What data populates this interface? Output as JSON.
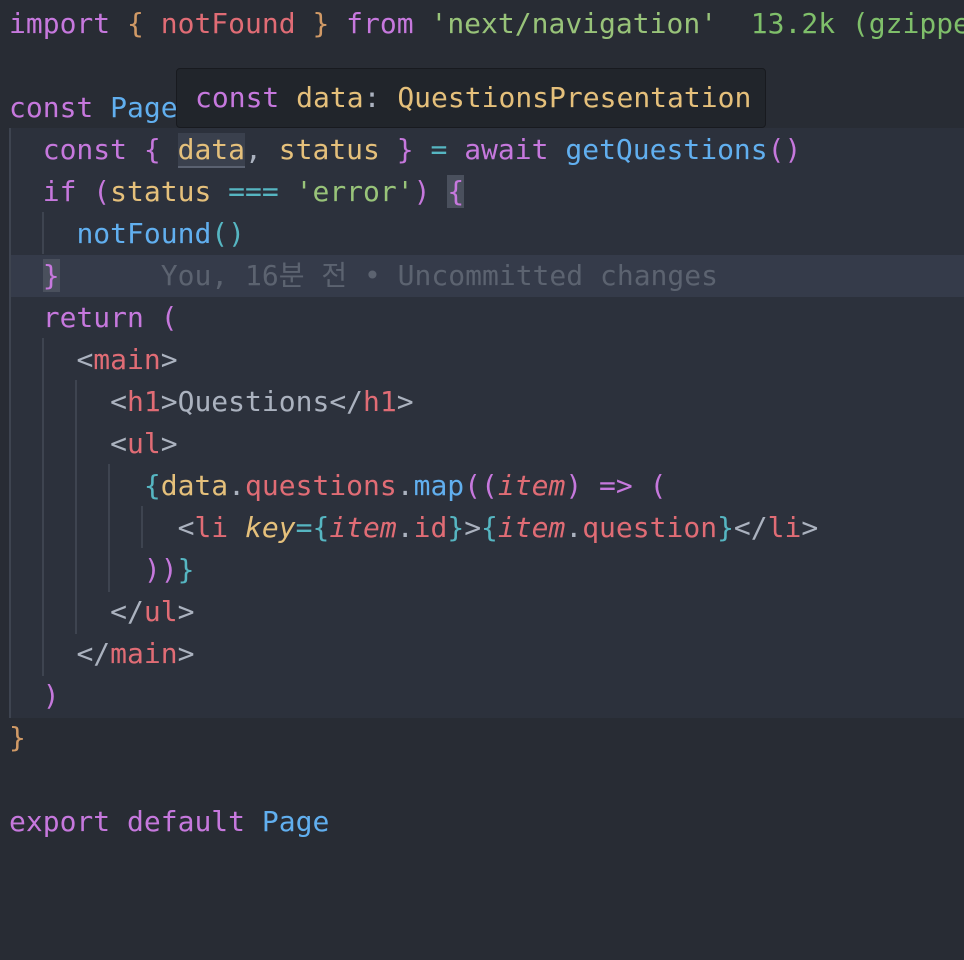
{
  "editor": {
    "lines": [
      {
        "tokens": [
          "import",
          " ",
          "{",
          " ",
          "notFound",
          " ",
          "}",
          " ",
          "from",
          " ",
          "'next/navigation'"
        ]
      },
      {
        "tokens": []
      },
      {
        "tokens": [
          "const",
          " ",
          "Page"
        ]
      },
      {
        "tokens": [
          "  ",
          "const",
          " ",
          "{",
          " ",
          "data",
          ",",
          " ",
          "status",
          " ",
          "}",
          " ",
          "=",
          " ",
          "await",
          " ",
          "getQuestions",
          "()"
        ]
      },
      {
        "tokens": [
          "  ",
          "if",
          " ",
          "(",
          "status",
          " ",
          "===",
          " ",
          "'error'",
          ")",
          " ",
          "{"
        ]
      },
      {
        "tokens": [
          "    ",
          "notFound",
          "()"
        ]
      },
      {
        "tokens": [
          "  ",
          "}"
        ]
      },
      {
        "tokens": [
          "  ",
          "return",
          " ",
          "("
        ]
      },
      {
        "tokens": [
          "    ",
          "<",
          "main",
          ">"
        ]
      },
      {
        "tokens": [
          "      ",
          "<",
          "h1",
          ">",
          "Questions",
          "</",
          "h1",
          ">"
        ]
      },
      {
        "tokens": [
          "      ",
          "<",
          "ul",
          ">"
        ]
      },
      {
        "tokens": [
          "        ",
          "{",
          "data",
          ".",
          "questions",
          ".",
          "map",
          "((",
          "item",
          ")",
          " ",
          "=>",
          " ",
          "("
        ]
      },
      {
        "tokens": [
          "          ",
          "<",
          "li",
          " ",
          "key",
          "=",
          "{",
          "item",
          ".",
          "id",
          "}",
          ">",
          "{",
          "item",
          ".",
          "question",
          "}",
          "</",
          "li",
          ">"
        ]
      },
      {
        "tokens": [
          "        ",
          "))",
          "}"
        ]
      },
      {
        "tokens": [
          "      ",
          "</",
          "ul",
          ">"
        ]
      },
      {
        "tokens": [
          "    ",
          "</",
          "main",
          ">"
        ]
      },
      {
        "tokens": [
          "  ",
          ")"
        ]
      },
      {
        "tokens": [
          "}"
        ]
      },
      {
        "tokens": []
      },
      {
        "tokens": [
          "export",
          " ",
          "default",
          " ",
          "Page"
        ]
      }
    ],
    "import_size_annotation": "13.2k (gzippe",
    "blame_annotation": "You, 16분 전 • Uncommitted changes",
    "tooltip": {
      "keyword": "const",
      "name": "data",
      "colon": ":",
      "type": "QuestionsPresentation"
    }
  },
  "colors": {
    "background": "#282c34",
    "keyword": "#c678dd",
    "function": "#61afef",
    "string": "#98c379",
    "variable": "#e06c75",
    "type": "#e5c07b",
    "tooltip_bg": "#21252b"
  }
}
